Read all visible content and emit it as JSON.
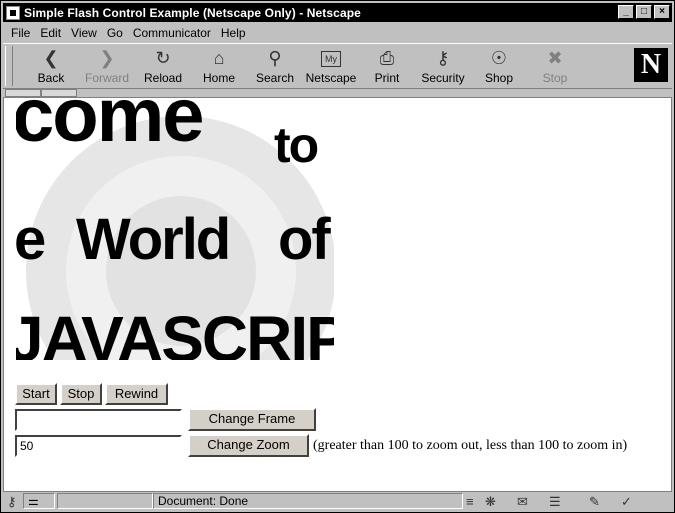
{
  "window": {
    "title": "Simple Flash Control Example (Netscape Only) - Netscape",
    "minimize_glyph": "_",
    "maximize_glyph": "□",
    "close_glyph": "×"
  },
  "menu": {
    "items": [
      "File",
      "Edit",
      "View",
      "Go",
      "Communicator",
      "Help"
    ]
  },
  "toolbar": {
    "buttons": [
      {
        "label": "Back",
        "icon": "back-arrow-icon",
        "enabled": true
      },
      {
        "label": "Forward",
        "icon": "forward-arrow-icon",
        "enabled": false
      },
      {
        "label": "Reload",
        "icon": "reload-icon",
        "enabled": true
      },
      {
        "label": "Home",
        "icon": "home-icon",
        "enabled": true
      },
      {
        "label": "Search",
        "icon": "search-icon",
        "enabled": true
      },
      {
        "label": "Netscape",
        "icon": "my-netscape-icon",
        "enabled": true
      },
      {
        "label": "Print",
        "icon": "print-icon",
        "enabled": true
      },
      {
        "label": "Security",
        "icon": "security-lock-icon",
        "enabled": true
      },
      {
        "label": "Shop",
        "icon": "shop-icon",
        "enabled": true
      },
      {
        "label": "Stop",
        "icon": "stop-icon",
        "enabled": false
      }
    ],
    "logo_letter": "N",
    "my_badge": "My"
  },
  "flash_movie": {
    "words": [
      "come",
      "to",
      "e",
      "World",
      "of",
      "JAVASCRIP"
    ]
  },
  "controls": {
    "start_label": "Start",
    "stop_label": "Stop",
    "rewind_label": "Rewind",
    "frame_input_value": "",
    "change_frame_label": "Change Frame",
    "zoom_input_value": "50",
    "change_zoom_label": "Change Zoom",
    "zoom_hint": "(greater than 100 to zoom out, less than 100 to zoom in)"
  },
  "status": {
    "text": "Document: Done"
  }
}
